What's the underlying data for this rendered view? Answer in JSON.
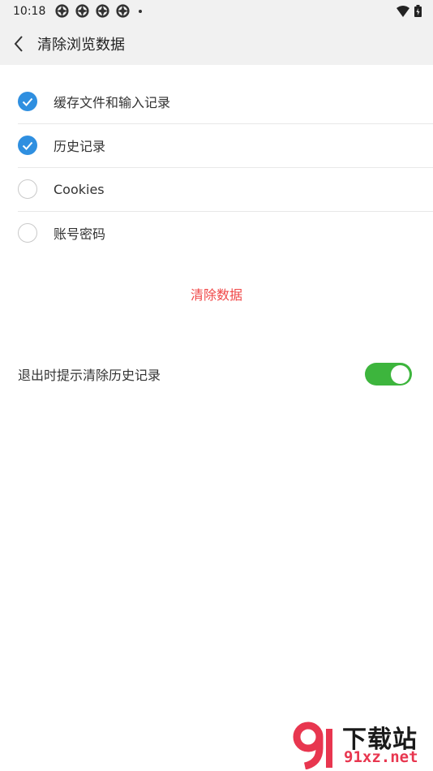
{
  "status_bar": {
    "time": "10:18"
  },
  "header": {
    "title": "清除浏览数据"
  },
  "options": [
    {
      "label": "缓存文件和输入记录",
      "checked": true
    },
    {
      "label": "历史记录",
      "checked": true
    },
    {
      "label": "Cookies",
      "checked": false
    },
    {
      "label": "账号密码",
      "checked": false
    }
  ],
  "clear_button": {
    "label": "清除数据"
  },
  "exit_prompt": {
    "label": "退出时提示清除历史记录",
    "enabled": true
  },
  "watermark": {
    "title": "下载站",
    "site": "91xz.net"
  },
  "colors": {
    "accent": "#2f8fe0",
    "danger": "#f04848",
    "switch_on": "#3db53d"
  }
}
